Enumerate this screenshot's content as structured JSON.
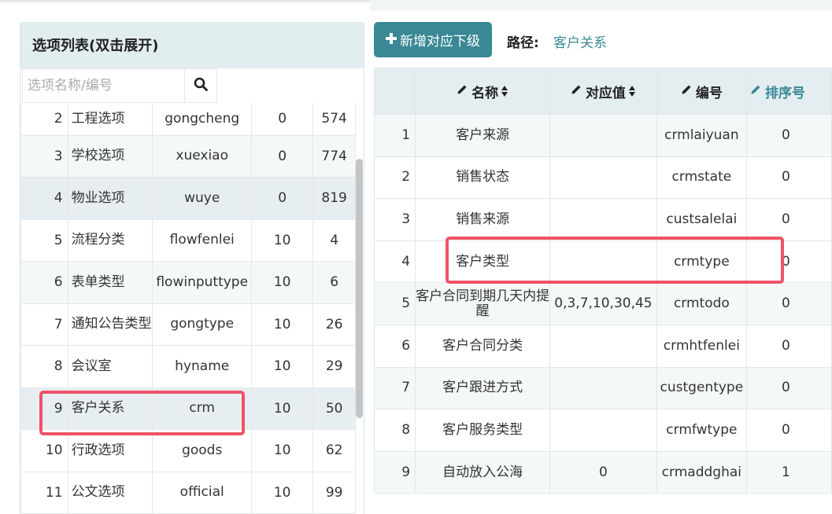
{
  "left_panel": {
    "title": "选项列表(双击展开)",
    "search": {
      "placeholder": "选项名称/编号",
      "value": ""
    },
    "rows": [
      {
        "num": "2",
        "name": "工程选项",
        "code": "gongcheng",
        "value": "0",
        "sort": "574"
      },
      {
        "num": "3",
        "name": "学校选项",
        "code": "xuexiao",
        "value": "0",
        "sort": "774"
      },
      {
        "num": "4",
        "name": "物业选项",
        "code": "wuye",
        "value": "0",
        "sort": "819"
      },
      {
        "num": "5",
        "name": "流程分类",
        "code": "flowfenlei",
        "value": "10",
        "sort": "4"
      },
      {
        "num": "6",
        "name": "表单类型",
        "code": "flowinputtype",
        "value": "10",
        "sort": "6"
      },
      {
        "num": "7",
        "name": "通知公告类型",
        "code": "gongtype",
        "value": "10",
        "sort": "26"
      },
      {
        "num": "8",
        "name": "会议室",
        "code": "hyname",
        "value": "10",
        "sort": "29"
      },
      {
        "num": "9",
        "name": "客户关系",
        "code": "crm",
        "value": "10",
        "sort": "50"
      },
      {
        "num": "10",
        "name": "行政选项",
        "code": "goods",
        "value": "10",
        "sort": "62"
      },
      {
        "num": "11",
        "name": "公文选项",
        "code": "official",
        "value": "10",
        "sort": "99"
      }
    ]
  },
  "toolbar": {
    "add_button_label": "新增对应下级",
    "path_label": "路径:",
    "path_value": "客户关系"
  },
  "right_table": {
    "headers": {
      "name": "名称",
      "value": "对应值",
      "code": "编号",
      "sort": "排序号"
    },
    "rows": [
      {
        "num": "1",
        "name": "客户来源",
        "value": "",
        "code": "crmlaiyuan",
        "sort": "0"
      },
      {
        "num": "2",
        "name": "销售状态",
        "value": "",
        "code": "crmstate",
        "sort": "0"
      },
      {
        "num": "3",
        "name": "销售来源",
        "value": "",
        "code": "custsalelai",
        "sort": "0"
      },
      {
        "num": "4",
        "name": "客户类型",
        "value": "",
        "code": "crmtype",
        "sort": "0"
      },
      {
        "num": "5",
        "name": "客户合同到期几天内提醒",
        "value": "0,3,7,10,30,45",
        "code": "crmtodo",
        "sort": "0"
      },
      {
        "num": "6",
        "name": "客户合同分类",
        "value": "",
        "code": "crmhtfenlei",
        "sort": "0"
      },
      {
        "num": "7",
        "name": "客户跟进方式",
        "value": "",
        "code": "custgentype",
        "sort": "0"
      },
      {
        "num": "8",
        "name": "客户服务类型",
        "value": "",
        "code": "crmfwtype",
        "sort": "0"
      },
      {
        "num": "9",
        "name": "自动放入公海",
        "value": "0",
        "code": "crmaddghai",
        "sort": "1"
      }
    ]
  },
  "colors": {
    "accent": "#3a8896",
    "highlight": "#ef5366",
    "header_bg": "#e2edf0"
  },
  "icons": {
    "search": "search-icon",
    "add": "plus-icon",
    "edit": "pencil-icon",
    "sort": "sort-icon"
  }
}
